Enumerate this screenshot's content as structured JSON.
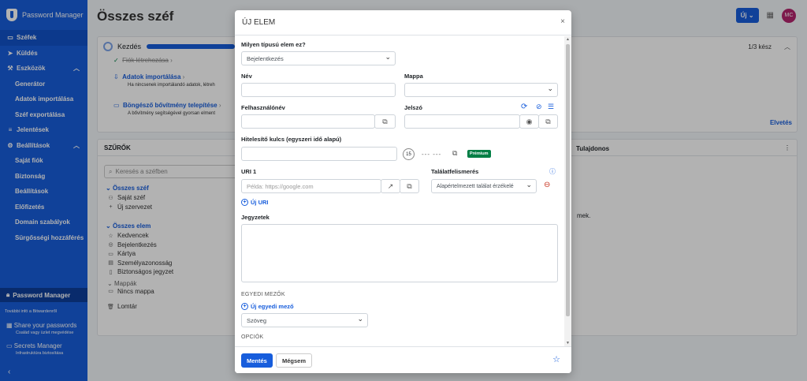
{
  "sidebar": {
    "app_name": "Password Manager",
    "items": [
      {
        "label": "Széfek",
        "icon": "vault-icon",
        "glyph": "▭"
      },
      {
        "label": "Küldés",
        "icon": "send-icon",
        "glyph": "➤"
      },
      {
        "label": "Eszközök",
        "icon": "tools-icon",
        "glyph": "⚒"
      }
    ],
    "tools_sub": [
      "Generátor",
      "Adatok importálása",
      "Széf exportálása"
    ],
    "reports": {
      "label": "Jelentések",
      "glyph": "≡"
    },
    "settings": {
      "label": "Beállítások",
      "glyph": "⚙"
    },
    "settings_sub": [
      "Saját fiók",
      "Biztonság",
      "Beállítások",
      "Előfizetés",
      "Domain szabályok",
      "Sürgősségi hozzáférés"
    ],
    "product_current": "Password Manager",
    "more_from": "További infó a Bitwardenről",
    "products": [
      {
        "name": "Share your passwords",
        "desc": "Család vagy üzlet megvédése"
      },
      {
        "name": "Secrets Manager",
        "desc": "Infrastruktúra biztosítása"
      }
    ]
  },
  "header": {
    "title": "Összes széf",
    "new_label": "Új",
    "avatar": "MC"
  },
  "getting_started": {
    "title": "Kezdés",
    "count": "1/3 kész",
    "dismiss": "Elvetés",
    "items": [
      {
        "title": "Fiók létrehozása",
        "desc": ""
      },
      {
        "title": "Adatok importálása",
        "desc": "Ha nincsenek importálandó adatok, létreh"
      },
      {
        "title": "Böngésző bővítmény telepítése",
        "desc": "A bővítmény segítségével gyorsan elment"
      }
    ]
  },
  "filters": {
    "title": "SZŰRŐK",
    "search_placeholder": "Keresés a széfben",
    "all_vaults": "Összes széf",
    "my_vault": "Saját széf",
    "new_org": "Új szervezet",
    "all_items": "Összes elem",
    "types": [
      "Kedvencek",
      "Bejelentkezés",
      "Kártya",
      "Személyazonosság",
      "Biztonságos jegyzet"
    ],
    "folders_label": "Mappák",
    "no_folder": "Nincs mappa",
    "trash": "Lomtár"
  },
  "list": {
    "owner_col": "Tulajdonos",
    "empty_text": "mek."
  },
  "modal": {
    "title": "ÚJ ELEM",
    "type_label": "Milyen típusú elem ez?",
    "type_value": "Bejelentkezés",
    "name_label": "Név",
    "folder_label": "Mappa",
    "username_label": "Felhasználónév",
    "password_label": "Jelszó",
    "totp_label": "Hitelesítő kulcs (egyszeri idő alapú)",
    "totp_timer": "15",
    "totp_code": "--- ---",
    "premium": "Prémium",
    "uri_label": "URI 1",
    "uri_placeholder": "Példa: https://google.com",
    "match_label": "Találatfelismerés",
    "match_value": "Alapértelmezett találat érzékelé",
    "new_uri": "Új URI",
    "notes_label": "Jegyzetek",
    "custom_fields": "EGYEDI MEZŐK",
    "new_custom_field": "Új egyedi mező",
    "field_type": "Szöveg",
    "options": "OPCIÓK",
    "save": "Mentés",
    "cancel": "Mégsem"
  },
  "colors": {
    "brand": "#175ddc",
    "premium": "#017e45",
    "avatar": "#b3246e"
  }
}
